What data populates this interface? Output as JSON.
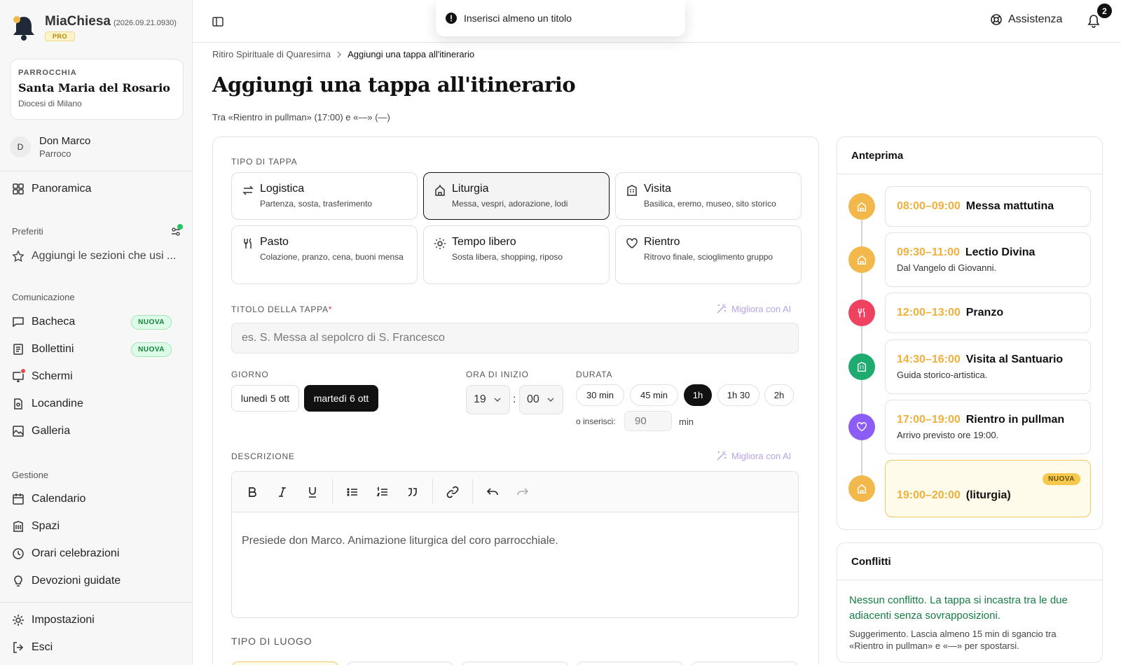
{
  "brand": {
    "name": "MiaChiesa",
    "version": "(2026.09.21.0930)",
    "badge": "PRO"
  },
  "parish": {
    "kicker": "PARROCCHIA",
    "name": "Santa Maria del Rosario",
    "diocese": "Diocesi di Milano"
  },
  "user": {
    "initial": "D",
    "name": "Don Marco",
    "role": "Parroco"
  },
  "nav": {
    "overview": "Panoramica",
    "favorites_title": "Preferiti",
    "favorites_add": "Aggiungi le sezioni che usi ...",
    "comms_title": "Comunicazione",
    "bacheca": "Bacheca",
    "bollettini": "Bollettini",
    "schermi": "Schermi",
    "locandine": "Locandine",
    "galleria": "Galleria",
    "new_badge": "NUOVA",
    "mgmt_title": "Gestione",
    "calendario": "Calendario",
    "spazi": "Spazi",
    "orari": "Orari celebrazioni",
    "devozioni": "Devozioni guidate",
    "impostazioni": "Impostazioni",
    "esci": "Esci"
  },
  "topbar": {
    "toast": "Inserisci almeno un titolo",
    "help": "Assistenza",
    "notifications": "2"
  },
  "breadcrumb": {
    "parent": "Ritiro Spirituale di Quaresima",
    "current": "Aggiungi una tappa all'itinerario"
  },
  "page": {
    "title": "Aggiungi una tappa all'itinerario",
    "subtitle": "Tra «Rientro in pullman» (17:00) e «—» (—)"
  },
  "form": {
    "type_label": "TIPO DI TAPPA",
    "types": [
      {
        "title": "Logistica",
        "desc": "Partenza, sosta, trasferimento",
        "icon": "arrows-swap-icon"
      },
      {
        "title": "Liturgia",
        "desc": "Messa, vespri, adorazione, lodi",
        "icon": "church-icon"
      },
      {
        "title": "Visita",
        "desc": "Basilica, eremo, museo, sito storico",
        "icon": "building-icon"
      },
      {
        "title": "Pasto",
        "desc": "Colazione, pranzo, cena, buoni mensa",
        "icon": "utensils-icon"
      },
      {
        "title": "Tempo libero",
        "desc": "Sosta libera, shopping, riposo",
        "icon": "sun-icon"
      },
      {
        "title": "Rientro",
        "desc": "Ritrovo finale, scioglimento gruppo",
        "icon": "heart-icon"
      }
    ],
    "selected_type": "Liturgia",
    "title_label": "TITOLO DELLA TAPPA",
    "required_mark": "*",
    "ai_label": "Migliora con AI",
    "title_placeholder": "es. S. Messa al sepolcro di S. Francesco",
    "day_label": "GIORNO",
    "days": [
      "lunedì 5 ott",
      "martedì 6 ott"
    ],
    "selected_day": "martedì 6 ott",
    "start_label": "ORA DI INIZIO",
    "start_hour": "19",
    "start_min": "00",
    "time_sep": ":",
    "duration_label": "DURATA",
    "durations": [
      "30 min",
      "45 min",
      "1h",
      "1h 30",
      "2h"
    ],
    "selected_duration": "1h",
    "or_insert": "o inserisci:",
    "custom_minutes": "90",
    "minutes_unit": "min",
    "desc_label": "DESCRIZIONE",
    "desc_text": "Presiede don Marco. Animazione liturgica del coro parrocchiale.",
    "place_label": "TIPO DI LUOGO"
  },
  "preview": {
    "title": "Anteprima",
    "items": [
      {
        "time": "08:00–09:00",
        "title": "Messa mattutina",
        "desc": "",
        "color": "#f2b84b",
        "icon": "church-icon"
      },
      {
        "time": "09:30–11:00",
        "title": "Lectio Divina",
        "desc": "Dal Vangelo di Giovanni.",
        "color": "#f2b84b",
        "icon": "church-icon"
      },
      {
        "time": "12:00–13:00",
        "title": "Pranzo",
        "desc": "",
        "color": "#ef4160",
        "icon": "utensils-icon"
      },
      {
        "time": "14:30–16:00",
        "title": "Visita al Santuario",
        "desc": "Guida storico-artistica.",
        "color": "#1faa6f",
        "icon": "building-icon"
      },
      {
        "time": "17:00–19:00",
        "title": "Rientro in pullman",
        "desc": "Arrivo previsto ore 19:00.",
        "color": "#8b5cf6",
        "icon": "heart-icon"
      },
      {
        "time": "19:00–20:00",
        "title": "(liturgia)",
        "desc": "",
        "color": "#f2b84b",
        "icon": "church-icon",
        "badge": "NUOVA"
      }
    ]
  },
  "conflicts": {
    "title": "Conflitti",
    "ok": "Nessun conflitto. La tappa si incastra tra le due adiacenti senza sovrapposizioni.",
    "suggestion": "Suggerimento. Lascia almeno 15 min di sgancio tra «Rientro in pullman» e «—» per spostarsi."
  }
}
